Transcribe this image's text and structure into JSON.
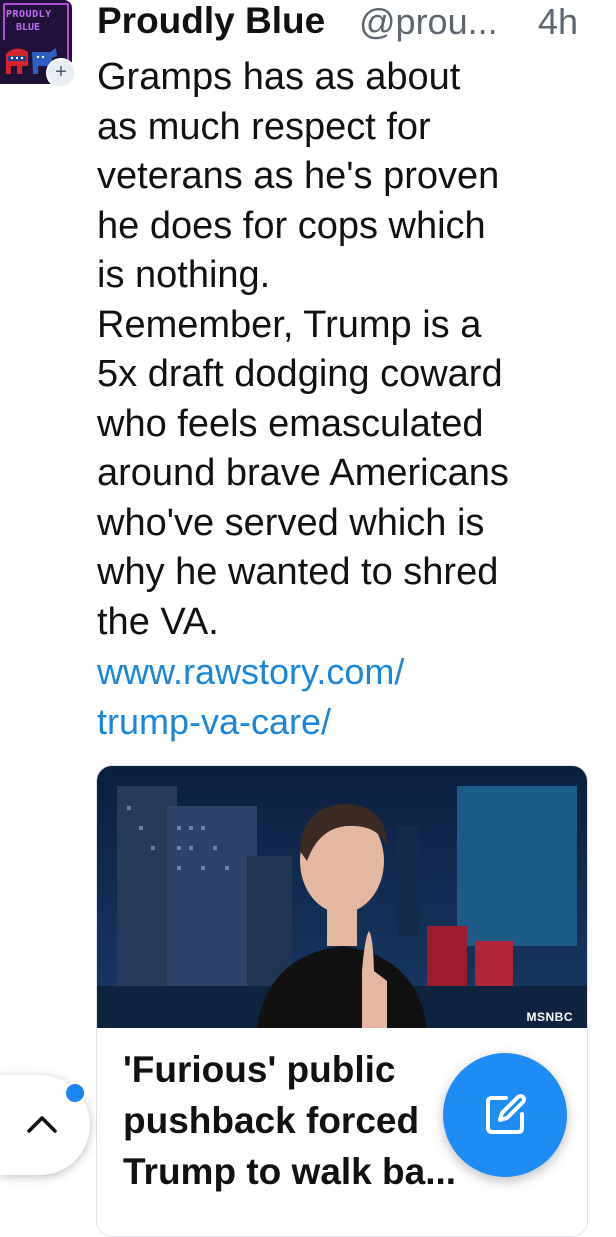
{
  "post": {
    "author": {
      "avatar_text_line1": "PROUDLY",
      "avatar_text_line2": "BLUE",
      "display_name": "Proudly Blue",
      "handle": "@prou...",
      "timestamp": "4h"
    },
    "follow_button_label": "+",
    "body_lines": [
      "Gramps has as about",
      "as much respect for",
      "veterans as he's proven",
      "he does for cops which",
      "is nothing.",
      "Remember, Trump is a",
      "5x draft dodging coward",
      "who feels emasculated",
      "around brave Americans",
      "who've served which is",
      "why he wanted to shred",
      "the VA."
    ],
    "link_lines": [
      "www.rawstory.com/",
      "trump-va-care/"
    ],
    "link_card": {
      "image_watermark": "MSNBC",
      "title_lines": [
        "'Furious' public",
        "pushback forced",
        "Trump to walk ba..."
      ]
    }
  },
  "ui": {
    "scroll_top_icon": "chevron-up-icon",
    "compose_icon": "edit-icon",
    "accent_color": "#1d8cf4",
    "link_color": "#1a86d9"
  }
}
